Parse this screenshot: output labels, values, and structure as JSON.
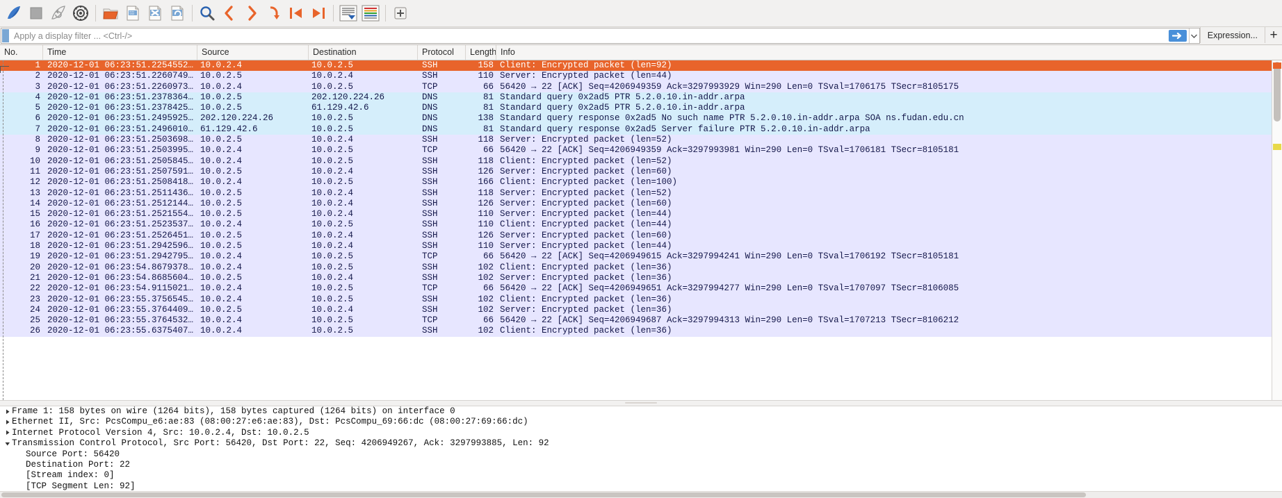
{
  "toolbar": {
    "buttons": [
      {
        "name": "start-capture-icon",
        "label": "Start"
      },
      {
        "name": "stop-capture-icon",
        "label": "Stop"
      },
      {
        "name": "restart-capture-icon",
        "label": "Restart"
      },
      {
        "name": "capture-options-icon",
        "label": "Capture options"
      },
      {
        "name": "open-file-icon",
        "label": "Open"
      },
      {
        "name": "save-file-icon",
        "label": "Save"
      },
      {
        "name": "close-file-icon",
        "label": "Close"
      },
      {
        "name": "reload-file-icon",
        "label": "Reload"
      },
      {
        "name": "find-packet-icon",
        "label": "Find packet"
      },
      {
        "name": "go-back-icon",
        "label": "Go back"
      },
      {
        "name": "go-forward-icon",
        "label": "Go forward"
      },
      {
        "name": "go-to-packet-icon",
        "label": "Go to packet"
      },
      {
        "name": "go-to-first-icon",
        "label": "Go to first packet"
      },
      {
        "name": "go-to-last-icon",
        "label": "Go to last packet"
      },
      {
        "name": "auto-scroll-icon",
        "label": "Auto scroll"
      },
      {
        "name": "colorize-icon",
        "label": "Colorize"
      },
      {
        "name": "zoom-in-icon",
        "label": "Zoom in"
      }
    ]
  },
  "filter": {
    "placeholder": "Apply a display filter ... <Ctrl-/>",
    "value": "",
    "apply_icon": "arrow-right-icon",
    "dropdown_icon": "chevron-down-icon",
    "expression_label": "Expression...",
    "add_label": "+",
    "bookmark_icon": "bookmark-icon"
  },
  "columns": [
    {
      "key": "no",
      "label": "No."
    },
    {
      "key": "time",
      "label": "Time"
    },
    {
      "key": "source",
      "label": "Source"
    },
    {
      "key": "destination",
      "label": "Destination"
    },
    {
      "key": "protocol",
      "label": "Protocol"
    },
    {
      "key": "length",
      "label": "Length"
    },
    {
      "key": "info",
      "label": "Info"
    }
  ],
  "packets": [
    {
      "no": "1",
      "time": "2020-12-01 06:23:51.2254552…",
      "source": "10.0.2.4",
      "destination": "10.0.2.5",
      "protocol": "SSH",
      "length": "158",
      "info": "Client: Encrypted packet (len=92)",
      "style": "sel"
    },
    {
      "no": "2",
      "time": "2020-12-01 06:23:51.2260749…",
      "source": "10.0.2.5",
      "destination": "10.0.2.4",
      "protocol": "SSH",
      "length": "110",
      "info": "Server: Encrypted packet (len=44)",
      "style": "tcp"
    },
    {
      "no": "3",
      "time": "2020-12-01 06:23:51.2260973…",
      "source": "10.0.2.4",
      "destination": "10.0.2.5",
      "protocol": "TCP",
      "length": "66",
      "info": "56420 → 22 [ACK] Seq=4206949359 Ack=3297993929 Win=290 Len=0 TSval=1706175 TSecr=8105175",
      "style": "tcp"
    },
    {
      "no": "4",
      "time": "2020-12-01 06:23:51.2378364…",
      "source": "10.0.2.5",
      "destination": "202.120.224.26",
      "protocol": "DNS",
      "length": "81",
      "info": "Standard query 0x2ad5 PTR 5.2.0.10.in-addr.arpa",
      "style": "dns"
    },
    {
      "no": "5",
      "time": "2020-12-01 06:23:51.2378425…",
      "source": "10.0.2.5",
      "destination": "61.129.42.6",
      "protocol": "DNS",
      "length": "81",
      "info": "Standard query 0x2ad5 PTR 5.2.0.10.in-addr.arpa",
      "style": "dns"
    },
    {
      "no": "6",
      "time": "2020-12-01 06:23:51.2495925…",
      "source": "202.120.224.26",
      "destination": "10.0.2.5",
      "protocol": "DNS",
      "length": "138",
      "info": "Standard query response 0x2ad5 No such name PTR 5.2.0.10.in-addr.arpa SOA ns.fudan.edu.cn",
      "style": "dns"
    },
    {
      "no": "7",
      "time": "2020-12-01 06:23:51.2496010…",
      "source": "61.129.42.6",
      "destination": "10.0.2.5",
      "protocol": "DNS",
      "length": "81",
      "info": "Standard query response 0x2ad5 Server failure PTR 5.2.0.10.in-addr.arpa",
      "style": "dns"
    },
    {
      "no": "8",
      "time": "2020-12-01 06:23:51.2503698…",
      "source": "10.0.2.5",
      "destination": "10.0.2.4",
      "protocol": "SSH",
      "length": "118",
      "info": "Server: Encrypted packet (len=52)",
      "style": "tcp"
    },
    {
      "no": "9",
      "time": "2020-12-01 06:23:51.2503995…",
      "source": "10.0.2.4",
      "destination": "10.0.2.5",
      "protocol": "TCP",
      "length": "66",
      "info": "56420 → 22 [ACK] Seq=4206949359 Ack=3297993981 Win=290 Len=0 TSval=1706181 TSecr=8105181",
      "style": "tcp"
    },
    {
      "no": "10",
      "time": "2020-12-01 06:23:51.2505845…",
      "source": "10.0.2.4",
      "destination": "10.0.2.5",
      "protocol": "SSH",
      "length": "118",
      "info": "Client: Encrypted packet (len=52)",
      "style": "tcp"
    },
    {
      "no": "11",
      "time": "2020-12-01 06:23:51.2507591…",
      "source": "10.0.2.5",
      "destination": "10.0.2.4",
      "protocol": "SSH",
      "length": "126",
      "info": "Server: Encrypted packet (len=60)",
      "style": "tcp"
    },
    {
      "no": "12",
      "time": "2020-12-01 06:23:51.2508418…",
      "source": "10.0.2.4",
      "destination": "10.0.2.5",
      "protocol": "SSH",
      "length": "166",
      "info": "Client: Encrypted packet (len=100)",
      "style": "tcp"
    },
    {
      "no": "13",
      "time": "2020-12-01 06:23:51.2511436…",
      "source": "10.0.2.5",
      "destination": "10.0.2.4",
      "protocol": "SSH",
      "length": "118",
      "info": "Server: Encrypted packet (len=52)",
      "style": "tcp"
    },
    {
      "no": "14",
      "time": "2020-12-01 06:23:51.2512144…",
      "source": "10.0.2.5",
      "destination": "10.0.2.4",
      "protocol": "SSH",
      "length": "126",
      "info": "Server: Encrypted packet (len=60)",
      "style": "tcp"
    },
    {
      "no": "15",
      "time": "2020-12-01 06:23:51.2521554…",
      "source": "10.0.2.5",
      "destination": "10.0.2.4",
      "protocol": "SSH",
      "length": "110",
      "info": "Server: Encrypted packet (len=44)",
      "style": "tcp"
    },
    {
      "no": "16",
      "time": "2020-12-01 06:23:51.2523537…",
      "source": "10.0.2.4",
      "destination": "10.0.2.5",
      "protocol": "SSH",
      "length": "110",
      "info": "Client: Encrypted packet (len=44)",
      "style": "tcp"
    },
    {
      "no": "17",
      "time": "2020-12-01 06:23:51.2526451…",
      "source": "10.0.2.5",
      "destination": "10.0.2.4",
      "protocol": "SSH",
      "length": "126",
      "info": "Server: Encrypted packet (len=60)",
      "style": "tcp"
    },
    {
      "no": "18",
      "time": "2020-12-01 06:23:51.2942596…",
      "source": "10.0.2.5",
      "destination": "10.0.2.4",
      "protocol": "SSH",
      "length": "110",
      "info": "Server: Encrypted packet (len=44)",
      "style": "tcp"
    },
    {
      "no": "19",
      "time": "2020-12-01 06:23:51.2942795…",
      "source": "10.0.2.4",
      "destination": "10.0.2.5",
      "protocol": "TCP",
      "length": "66",
      "info": "56420 → 22 [ACK] Seq=4206949615 Ack=3297994241 Win=290 Len=0 TSval=1706192 TSecr=8105181",
      "style": "tcp"
    },
    {
      "no": "20",
      "time": "2020-12-01 06:23:54.8679378…",
      "source": "10.0.2.4",
      "destination": "10.0.2.5",
      "protocol": "SSH",
      "length": "102",
      "info": "Client: Encrypted packet (len=36)",
      "style": "tcp"
    },
    {
      "no": "21",
      "time": "2020-12-01 06:23:54.8685604…",
      "source": "10.0.2.5",
      "destination": "10.0.2.4",
      "protocol": "SSH",
      "length": "102",
      "info": "Server: Encrypted packet (len=36)",
      "style": "tcp"
    },
    {
      "no": "22",
      "time": "2020-12-01 06:23:54.9115021…",
      "source": "10.0.2.4",
      "destination": "10.0.2.5",
      "protocol": "TCP",
      "length": "66",
      "info": "56420 → 22 [ACK] Seq=4206949651 Ack=3297994277 Win=290 Len=0 TSval=1707097 TSecr=8106085",
      "style": "tcp"
    },
    {
      "no": "23",
      "time": "2020-12-01 06:23:55.3756545…",
      "source": "10.0.2.4",
      "destination": "10.0.2.5",
      "protocol": "SSH",
      "length": "102",
      "info": "Client: Encrypted packet (len=36)",
      "style": "tcp"
    },
    {
      "no": "24",
      "time": "2020-12-01 06:23:55.3764409…",
      "source": "10.0.2.5",
      "destination": "10.0.2.4",
      "protocol": "SSH",
      "length": "102",
      "info": "Server: Encrypted packet (len=36)",
      "style": "tcp"
    },
    {
      "no": "25",
      "time": "2020-12-01 06:23:55.3764532…",
      "source": "10.0.2.4",
      "destination": "10.0.2.5",
      "protocol": "TCP",
      "length": "66",
      "info": "56420 → 22 [ACK] Seq=4206949687 Ack=3297994313 Win=290 Len=0 TSval=1707213 TSecr=8106212",
      "style": "tcp"
    },
    {
      "no": "26",
      "time": "2020-12-01 06:23:55.6375407…",
      "source": "10.0.2.4",
      "destination": "10.0.2.5",
      "protocol": "SSH",
      "length": "102",
      "info": "Client: Encrypted packet (len=36)",
      "style": "tcp"
    }
  ],
  "detail": {
    "rows": [
      {
        "indent": 0,
        "expanded": false,
        "text": "Frame 1: 158 bytes on wire (1264 bits), 158 bytes captured (1264 bits) on interface 0"
      },
      {
        "indent": 0,
        "expanded": false,
        "text": "Ethernet II, Src: PcsCompu_e6:ae:83 (08:00:27:e6:ae:83), Dst: PcsCompu_69:66:dc (08:00:27:69:66:dc)"
      },
      {
        "indent": 0,
        "expanded": false,
        "text": "Internet Protocol Version 4, Src: 10.0.2.4, Dst: 10.0.2.5"
      },
      {
        "indent": 0,
        "expanded": true,
        "text": "Transmission Control Protocol, Src Port: 56420, Dst Port: 22, Seq: 4206949267, Ack: 3297993885, Len: 92"
      },
      {
        "indent": 1,
        "expanded": null,
        "text": "Source Port: 56420"
      },
      {
        "indent": 1,
        "expanded": null,
        "text": "Destination Port: 22"
      },
      {
        "indent": 1,
        "expanded": null,
        "text": "[Stream index: 0]"
      },
      {
        "indent": 1,
        "expanded": null,
        "text": "[TCP Segment Len: 92]"
      }
    ]
  },
  "colors": {
    "selected_row": "#e8642b",
    "tcp_row": "#e7e6ff",
    "dns_row": "#d5eefb",
    "accent_blue": "#4a90d9",
    "toolbar_bg": "#f2f1f0"
  }
}
